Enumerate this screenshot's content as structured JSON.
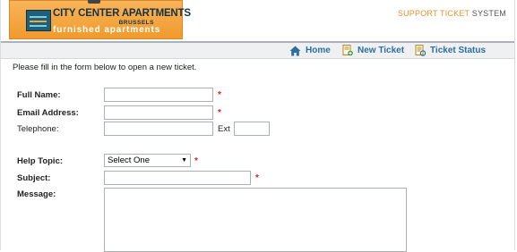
{
  "header": {
    "logo_name": "CITY CENTER APARTMENTS",
    "logo_city": "BRUSSELS",
    "logo_sub": "furnished apartments",
    "system_accent": "SUPPORT TICKET",
    "system_rest": " SYSTEM"
  },
  "nav": [
    {
      "label": "Home",
      "icon": "home-icon"
    },
    {
      "label": "New Ticket",
      "icon": "new-ticket-icon"
    },
    {
      "label": "Ticket Status",
      "icon": "ticket-status-icon"
    }
  ],
  "intro_text": "Please fill in the form below to open a new ticket.",
  "form": {
    "full_name_label": "Full Name:",
    "full_name_value": "",
    "email_label": "Email Address:",
    "email_value": "",
    "telephone_label": "Telephone:",
    "telephone_value": "",
    "ext_label": "Ext",
    "ext_value": "",
    "help_topic_label": "Help Topic:",
    "help_topic_selected": "Select One",
    "subject_label": "Subject:",
    "subject_value": "",
    "message_label": "Message:",
    "message_value": "",
    "required_marker": "*"
  },
  "colors": {
    "brand_orange": "#f09a2c",
    "link_blue": "#2d6ea0",
    "required_red": "#dd2222"
  }
}
